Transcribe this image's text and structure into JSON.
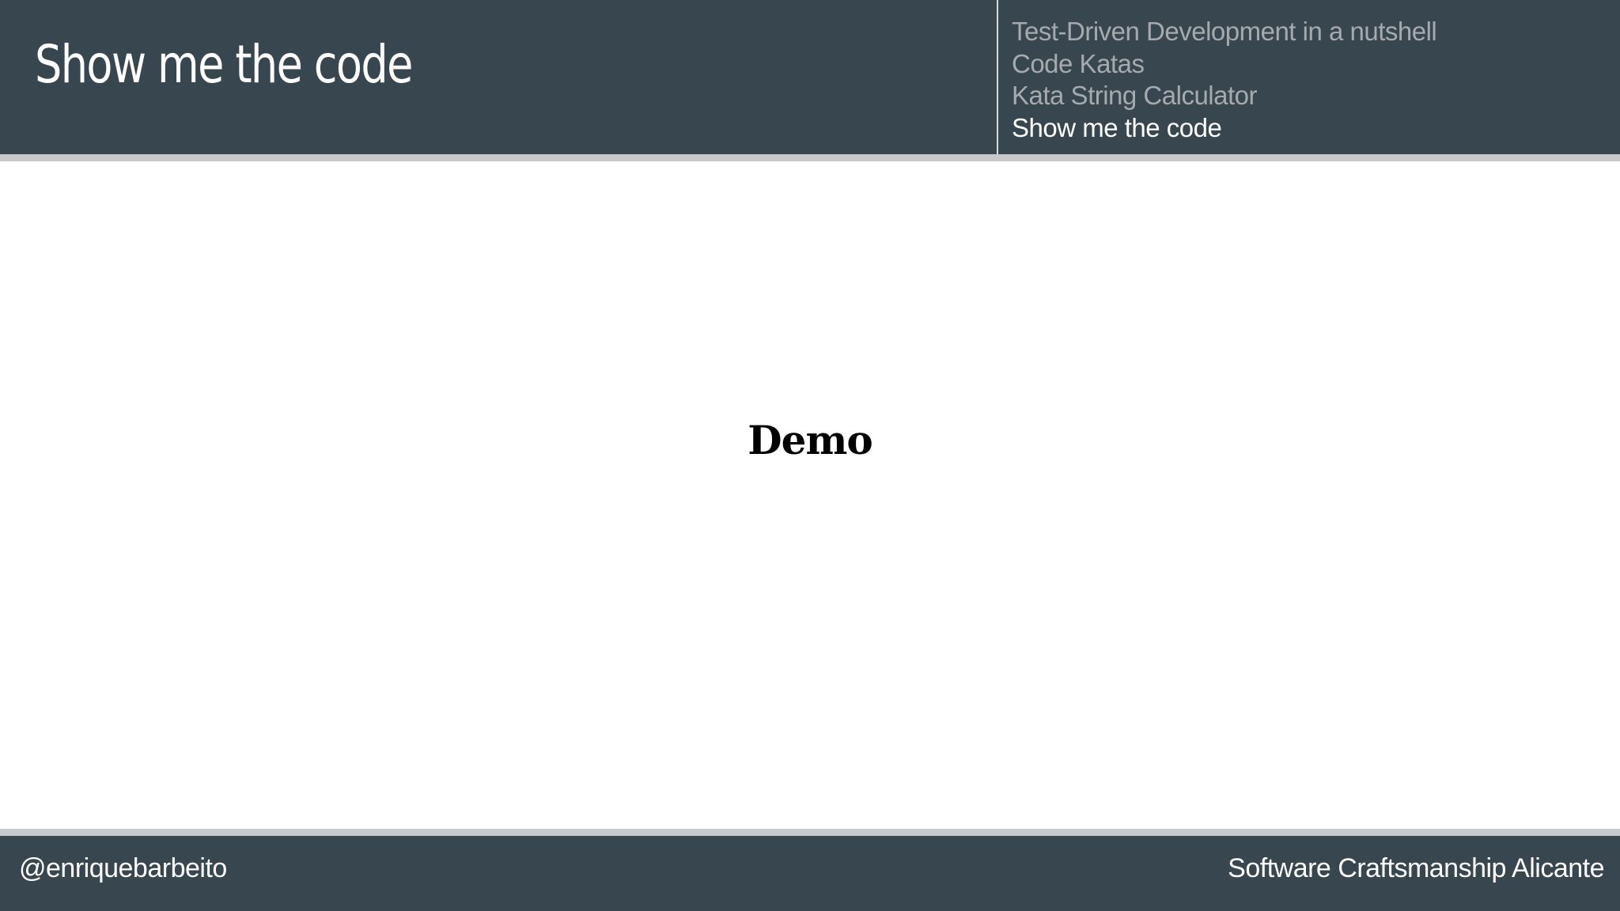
{
  "header": {
    "title": "Show me the code",
    "background_color": "#37464f",
    "toc": [
      {
        "label": "Test-Driven Development in a nutshell",
        "current": false
      },
      {
        "label": "Code Katas",
        "current": false
      },
      {
        "label": "Kata String Calculator",
        "current": false
      },
      {
        "label": "Show me the code",
        "current": true
      }
    ]
  },
  "content": {
    "text": "Demo"
  },
  "footer": {
    "left_text": "@enriquebarbeito",
    "right_text": "Software Craftsmanship Alicante",
    "background_color": "#37464f"
  }
}
